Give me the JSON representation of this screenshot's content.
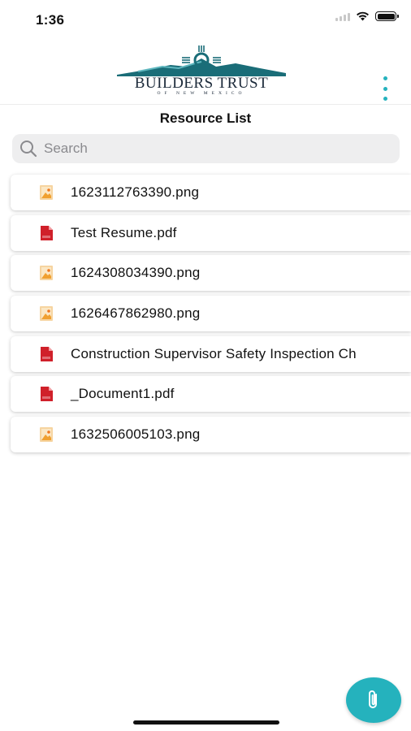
{
  "status_bar": {
    "time": "1:36"
  },
  "header": {
    "logo_text": "BUILDERS TRUST",
    "logo_subtext": "OF NEW MEXICO"
  },
  "page": {
    "title": "Resource List"
  },
  "search": {
    "placeholder": "Search",
    "value": ""
  },
  "resources": [
    {
      "name": "1623112763390.png",
      "type": "image"
    },
    {
      "name": "Test Resume.pdf",
      "type": "pdf"
    },
    {
      "name": "1624308034390.png",
      "type": "image"
    },
    {
      "name": "1626467862980.png",
      "type": "image"
    },
    {
      "name": "Construction Supervisor Safety Inspection Ch",
      "type": "pdf"
    },
    {
      "name": "_Document1.pdf",
      "type": "pdf"
    },
    {
      "name": "1632506005103.png",
      "type": "image"
    }
  ],
  "colors": {
    "accent": "#25b2bd",
    "pdf_red": "#d0202a",
    "image_orange": "#f0a030"
  },
  "icons": {
    "search": "search-icon",
    "more": "more-vertical-icon",
    "attach": "paperclip-icon",
    "pdf": "pdf-file-icon",
    "image": "image-file-icon"
  }
}
